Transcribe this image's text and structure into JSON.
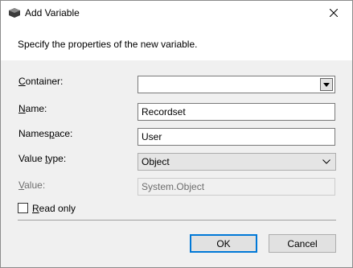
{
  "window": {
    "title": "Add Variable"
  },
  "header": {
    "text": "Specify the properties of the new variable."
  },
  "fields": {
    "container": {
      "label_prefix": "",
      "label_mnemonic": "C",
      "label_rest": "ontainer:",
      "value": ""
    },
    "name": {
      "label_prefix": "",
      "label_mnemonic": "N",
      "label_rest": "ame:",
      "value": "Recordset"
    },
    "namespace": {
      "label_prefix": "Names",
      "label_mnemonic": "p",
      "label_rest": "ace:",
      "value": "User"
    },
    "value_type": {
      "label_prefix": "Value ",
      "label_mnemonic": "t",
      "label_rest": "ype:",
      "value": "Object"
    },
    "value": {
      "label_prefix": "",
      "label_mnemonic": "V",
      "label_rest": "alue:",
      "value": "System.Object"
    }
  },
  "read_only": {
    "label_mnemonic": "R",
    "label_rest": "ead only",
    "checked": false
  },
  "buttons": {
    "ok": "OK",
    "cancel": "Cancel"
  }
}
